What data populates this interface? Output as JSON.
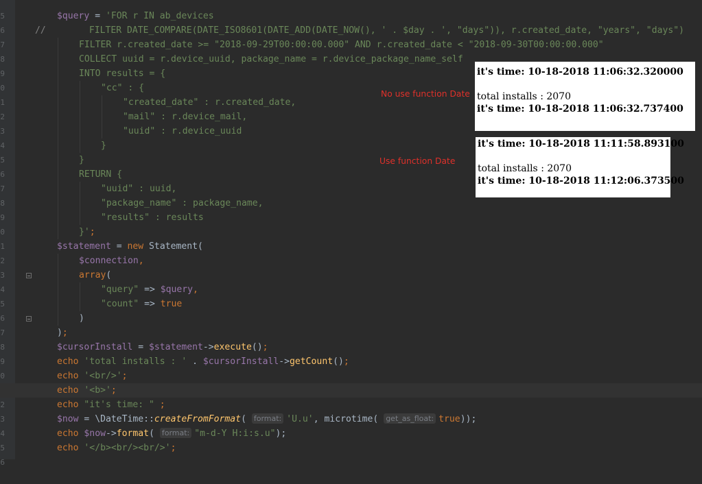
{
  "gutter": {
    "line_numbers": [
      "5",
      "6",
      "7",
      "8",
      "9",
      "0",
      "1",
      "2",
      "3",
      "4",
      "5",
      "6",
      "7",
      "8",
      "9",
      "0",
      "1",
      "2",
      "3",
      "4",
      "5",
      "6",
      "7",
      "8",
      "9",
      "0",
      "1",
      "2",
      "3",
      "4",
      "5",
      "6"
    ]
  },
  "code": {
    "l0": {
      "a": "$query",
      "b": " = ",
      "c": "'FOR r IN ab_devices"
    },
    "l1": {
      "a": "//",
      "b": "        FILTER DATE_COMPARE(DATE_ISO8601(DATE_ADD(DATE_NOW(), ' . $day . ', \"days\")), r.created_date, \"years\", \"days\")"
    },
    "l2": {
      "a": "FILTER r.created_date >= \"2018-09-29T00:00:00.000\" AND r.created_date < \"2018-09-30T00:00:00.000\""
    },
    "l3": {
      "a": "COLLECT uuid = r.device_uuid, package_name = r.device_package_name_self"
    },
    "l4": {
      "a": "INTO results = {"
    },
    "l5": {
      "a": "\"cc\" : {"
    },
    "l6": {
      "a": "\"created_date\" : r.created_date,"
    },
    "l7": {
      "a": "\"mail\" : r.device_mail,"
    },
    "l8": {
      "a": "\"uuid\" : r.device_uuid"
    },
    "l9": {
      "a": "}"
    },
    "l10": {
      "a": "}"
    },
    "l11": {
      "a": "RETURN {"
    },
    "l12": {
      "a": "\"uuid\" : uuid,"
    },
    "l13": {
      "a": "\"package_name\" : package_name,"
    },
    "l14": {
      "a": "\"results\" : results"
    },
    "l15": {
      "a": "}'",
      "b": ";"
    },
    "l16": {
      "a": "$statement",
      "b": " = ",
      "c": "new ",
      "d": "Statement("
    },
    "l17": {
      "a": "$connection",
      ",": ",",
      "b": ","
    },
    "l18": {
      "a": "array",
      "b": "("
    },
    "l19": {
      "a": "\"query\"",
      "b": " => ",
      "c": "$query",
      ",": ",",
      "d": ","
    },
    "l20": {
      "a": "\"count\"",
      "b": " => ",
      "c": "true"
    },
    "l21": {
      "a": ")"
    },
    "l22": {
      "a": ")",
      ";": ";",
      "b": ";"
    },
    "l23": {
      "a": "$cursorInstall",
      "b": " = ",
      "c": "$statement",
      "d": "->",
      "e": "execute",
      "f": "()",
      ";": ";",
      "g": ";"
    },
    "l24": {
      "a": "echo ",
      "b": "'total installs : '",
      "c": " . ",
      "d": "$cursorInstall",
      "e": "->",
      "f": "getCount",
      "g": "()",
      "h": ";"
    },
    "l25": {
      "a": "echo ",
      "b": "'<br/>'",
      "c": ";"
    },
    "l26": {
      "a": "echo ",
      "b": "'<b>'",
      "c": ";"
    },
    "l27": {
      "a": "echo ",
      "b": "\"it's time: \"",
      "c": " ;"
    },
    "l28": {
      "a": "$now",
      "b": " = \\DateTime::",
      "c": "createFromFormat",
      "d": "(",
      "hint1": "format:",
      "e": "'U.u'",
      "f": ", microtime(",
      "hint2": "get_as_float:",
      "g": "true",
      "h": "));"
    },
    "l29": {
      "a": "echo ",
      "b": "$now",
      "c": "->",
      "d": "format",
      "e": "(",
      "hint": "format:",
      "f": "\"m-d-Y H:i:s.u\"",
      "g": ");"
    },
    "l30": {
      "a": "echo ",
      "b": "'</b><br/><br/>'",
      "c": ";"
    }
  },
  "panel1": {
    "line1": "it's time: 10-18-2018 11:06:32.320000",
    "line2": "total installs : 2070",
    "line3": "it's time: 10-18-2018 11:06:32.737400"
  },
  "panel2": {
    "line1": "it's time: 10-18-2018 11:11:58.893100",
    "line2": "total installs : 2070",
    "line3": "it's time: 10-18-2018 11:12:06.373500"
  },
  "notes": {
    "no_use": "No use function Date",
    "use": "Use function Date"
  },
  "colors": {
    "background": "#2b2b2b",
    "keyword": "#cc7832",
    "string": "#6a8759",
    "variable": "#9876aa",
    "function": "#ffc66d",
    "annotation": "#e0312b"
  }
}
